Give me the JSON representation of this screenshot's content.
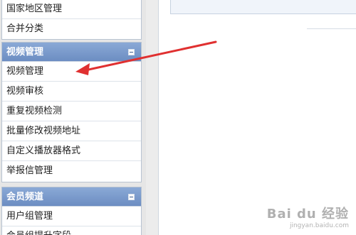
{
  "sidebar": {
    "top_items": [
      "国家地区管理",
      "合并分类"
    ],
    "video_panel": {
      "title": "视频管理",
      "items": [
        "视频管理",
        "视频审核",
        "重复视频检测",
        "批量修改视频地址",
        "自定义播放器格式",
        "举报信管理"
      ]
    },
    "member_panel": {
      "title": "会员频道",
      "items": [
        "用户组管理",
        "会员组提升字段"
      ]
    }
  },
  "annotation": {
    "type": "arrow",
    "color": "#e03030"
  },
  "watermark": {
    "brand": "Bai du 经验",
    "url": "jingyan.baidu.com"
  }
}
